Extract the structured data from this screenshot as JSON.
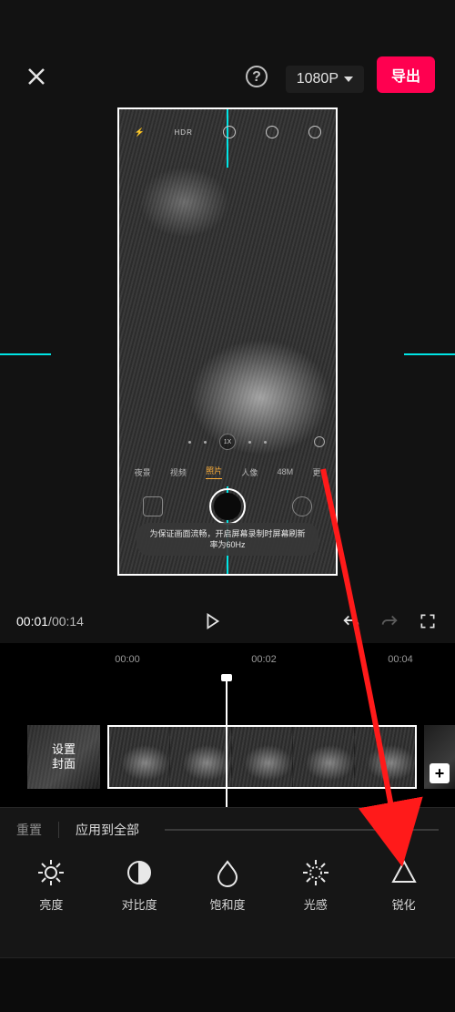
{
  "topbar": {
    "resolution_label": "1080P",
    "export_label": "导出"
  },
  "preview": {
    "phone_ui": {
      "hdr_label": "HDR",
      "zoom_label": "1X",
      "modes": {
        "night": "夜景",
        "video": "视频",
        "photo": "照片",
        "portrait": "人像",
        "hires": "48M",
        "more": "更"
      },
      "toast_text": "为保证画面流畅，开启屏幕录制时屏幕刷新率为60Hz"
    }
  },
  "transport": {
    "current_time": "00:01",
    "total_time": "00:14"
  },
  "timeline": {
    "ticks": {
      "t0": "00:00",
      "t1": "00:02",
      "t2": "00:04"
    },
    "cover_label": "设置\n封面"
  },
  "adjust": {
    "reset_label": "重置",
    "apply_all_label": "应用到全部",
    "tools": {
      "brightness": "亮度",
      "contrast": "对比度",
      "saturation": "饱和度",
      "light": "光感",
      "sharpen": "锐化"
    }
  },
  "colors": {
    "accent": "#ff0050",
    "guide": "#00e5e5",
    "arrow": "#ff1a1a"
  }
}
